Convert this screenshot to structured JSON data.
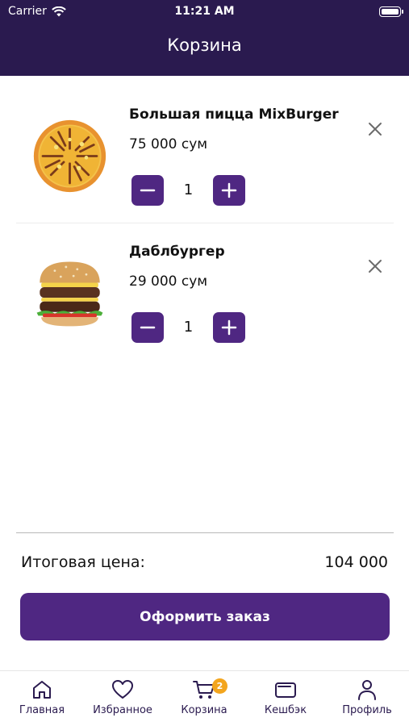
{
  "status_bar": {
    "carrier": "Carrier",
    "time": "11:21 AM"
  },
  "header": {
    "title": "Корзина"
  },
  "cart": {
    "items": [
      {
        "name": "Большая пицца MixBurger",
        "price": "75 000 сум",
        "quantity": "1",
        "image_icon": "pizza-image"
      },
      {
        "name": "Даблбургер",
        "price": "29 000 сум",
        "quantity": "1",
        "image_icon": "burger-image"
      }
    ]
  },
  "summary": {
    "total_label": "Итоговая цена:",
    "total_value": "104 000"
  },
  "checkout": {
    "label": "Оформить заказ"
  },
  "tabbar": {
    "items": [
      {
        "label": "Главная",
        "icon": "home-icon"
      },
      {
        "label": "Избранное",
        "icon": "heart-icon"
      },
      {
        "label": "Корзина",
        "icon": "cart-icon",
        "badge": "2"
      },
      {
        "label": "Кешбэк",
        "icon": "wallet-icon"
      },
      {
        "label": "Профиль",
        "icon": "profile-icon"
      }
    ]
  },
  "colors": {
    "header_bg": "#2a1a4f",
    "accent": "#4f2782",
    "badge": "#f3a51d"
  }
}
